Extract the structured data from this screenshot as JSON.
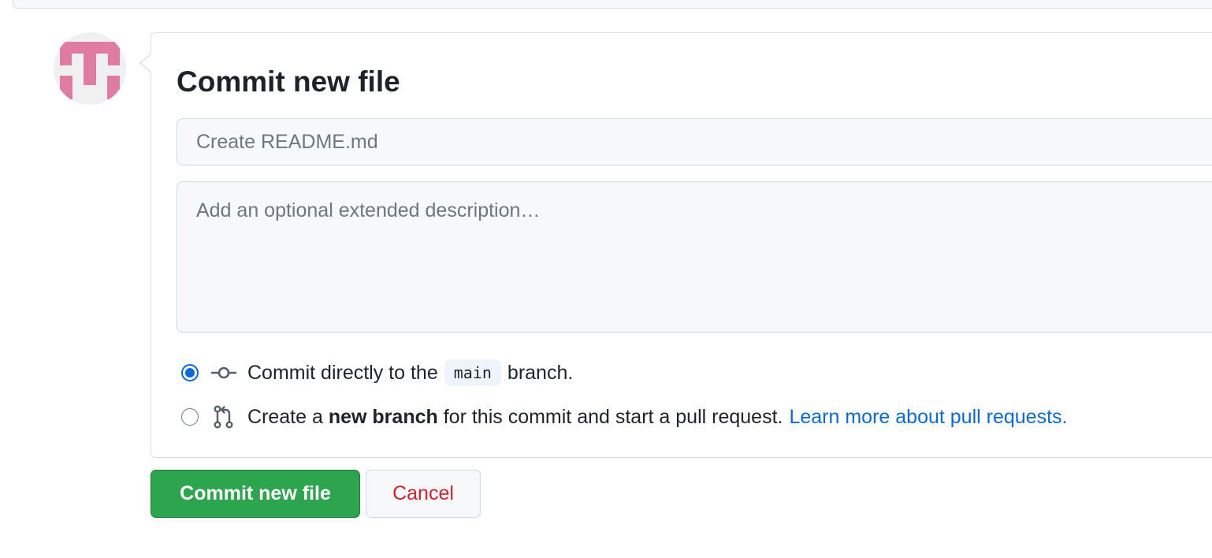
{
  "commit_form": {
    "title": "Commit new file",
    "summary_placeholder": "Create README.md",
    "summary_value": "",
    "description_placeholder": "Add an optional extended description…",
    "description_value": ""
  },
  "options": {
    "direct": {
      "text_before": "Commit directly to the",
      "branch": "main",
      "text_after": "branch.",
      "checked": true
    },
    "new_branch": {
      "text_before": "Create a",
      "bold": "new branch",
      "text_after": "for this commit and start a pull request.",
      "link": "Learn more about pull requests.",
      "checked": false
    }
  },
  "buttons": {
    "commit_label": "Commit new file",
    "cancel_label": "Cancel"
  },
  "icons": {
    "avatar": "identicon-avatar",
    "commit": "git-commit-icon",
    "pull_request": "git-pull-request-icon"
  },
  "colors": {
    "primary_button": "#2da44e",
    "danger_text": "#cf222e",
    "link": "#0969da",
    "avatar_pink": "#e07ba1"
  }
}
